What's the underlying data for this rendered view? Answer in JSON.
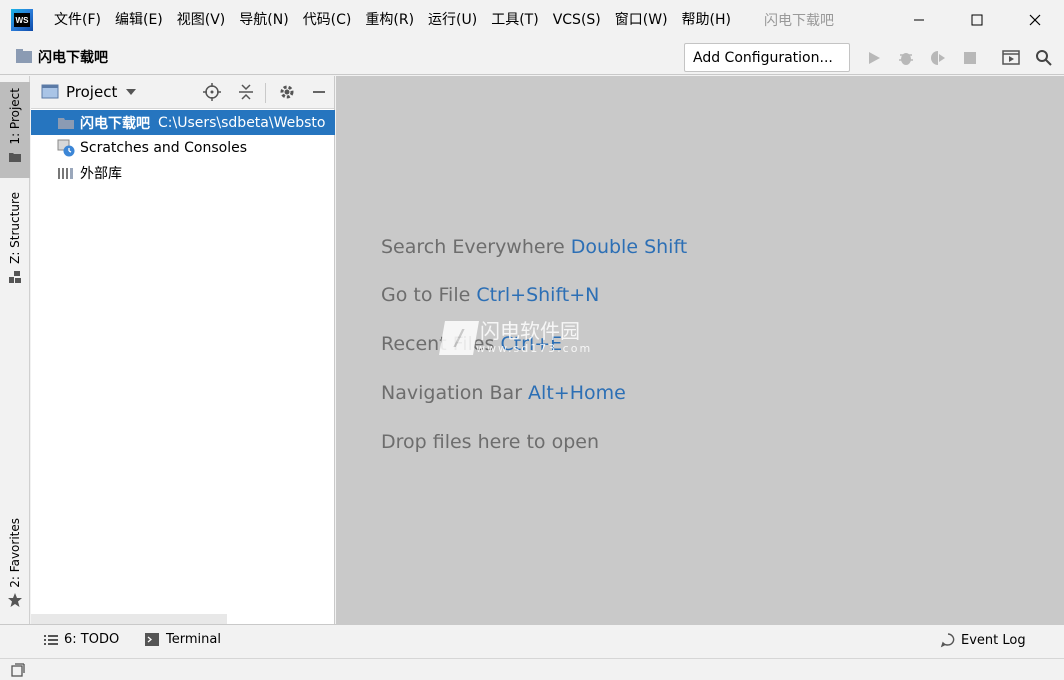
{
  "app": {
    "logo_text": "WS",
    "title": "闪电下载吧"
  },
  "menu": [
    {
      "label": "文件(F)"
    },
    {
      "label": "编辑(E)"
    },
    {
      "label": "视图(V)"
    },
    {
      "label": "导航(N)"
    },
    {
      "label": "代码(C)"
    },
    {
      "label": "重构(R)"
    },
    {
      "label": "运行(U)"
    },
    {
      "label": "工具(T)"
    },
    {
      "label": "VCS(S)"
    },
    {
      "label": "窗口(W)"
    },
    {
      "label": "帮助(H)"
    }
  ],
  "navbar": {
    "project_name": "闪电下载吧",
    "add_configuration": "Add Configuration..."
  },
  "left_strip": {
    "project_tab": "1: Project",
    "structure_tab": "Z: Structure",
    "favorites_tab": "2: Favorites"
  },
  "project_panel": {
    "title": "Project",
    "tree": [
      {
        "name": "闪电下载吧",
        "path": "C:\\Users\\sdbeta\\Websto",
        "selected": true
      },
      {
        "name": "Scratches and Consoles",
        "path": "",
        "selected": false
      },
      {
        "name": "外部库",
        "path": "",
        "selected": false
      }
    ]
  },
  "editor_hints": [
    {
      "text": "Search Everywhere ",
      "key": "Double Shift"
    },
    {
      "text": "Go to File ",
      "key": "Ctrl+Shift+N"
    },
    {
      "text": "Recent Files ",
      "key": "Ctrl+E"
    },
    {
      "text": "Navigation Bar ",
      "key": "Alt+Home"
    },
    {
      "text": "Drop files here to open",
      "key": ""
    }
  ],
  "watermark": {
    "name": "闪电软件园",
    "url": "www.sd173.com"
  },
  "bottom_bar": {
    "todo": "6: TODO",
    "terminal": "Terminal",
    "event_log": "Event Log"
  },
  "colors": {
    "selection": "#2675bf",
    "key_hint": "#2c6fb5",
    "editor_bg": "#c9c9c9"
  }
}
